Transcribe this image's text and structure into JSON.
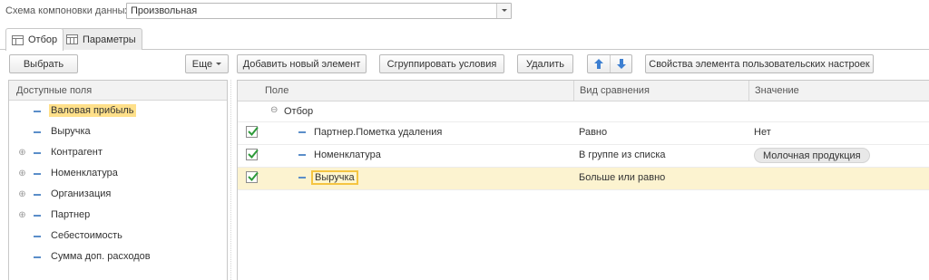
{
  "schema": {
    "label": "Схема компоновки данных:",
    "value": "Произвольная"
  },
  "tabs": [
    {
      "label": "Отбор",
      "icon": "filter-icon",
      "active": true
    },
    {
      "label": "Параметры",
      "icon": "parameters-icon",
      "active": false
    }
  ],
  "left_toolbar": {
    "select": "Выбрать",
    "more": "Еще"
  },
  "toolbar": {
    "add": "Добавить новый элемент",
    "group": "Сгруппировать условия",
    "delete": "Удалить",
    "properties": "Свойства элемента пользовательских настроек"
  },
  "available_fields": {
    "header": "Доступные поля",
    "items": [
      {
        "label": "Валовая прибыль",
        "expandable": false,
        "highlighted": true
      },
      {
        "label": "Выручка",
        "expandable": false,
        "highlighted": false
      },
      {
        "label": "Контрагент",
        "expandable": true,
        "highlighted": false
      },
      {
        "label": "Номенклатура",
        "expandable": true,
        "highlighted": false
      },
      {
        "label": "Организация",
        "expandable": true,
        "highlighted": false
      },
      {
        "label": "Партнер",
        "expandable": true,
        "highlighted": false
      },
      {
        "label": "Себестоимость",
        "expandable": false,
        "highlighted": false
      },
      {
        "label": "Сумма доп. расходов",
        "expandable": false,
        "highlighted": false
      }
    ]
  },
  "filter_grid": {
    "columns": [
      "Поле",
      "Вид сравнения",
      "Значение"
    ],
    "group_label": "Отбор",
    "rows": [
      {
        "checked": true,
        "field": "Партнер.Пометка удаления",
        "comparison": "Равно",
        "value": "Нет"
      },
      {
        "checked": true,
        "field": "Номенклатура",
        "comparison": "В группе из списка",
        "value": "Молочная продукция"
      },
      {
        "checked": true,
        "field": "Выручка",
        "comparison": "Больше или равно",
        "value": ""
      }
    ]
  },
  "colors": {
    "accent_blue": "#5b8ec9",
    "highlight_yellow": "#ffe08a",
    "selected_row": "#fcf3d0",
    "check_green": "#2e9b3a"
  }
}
